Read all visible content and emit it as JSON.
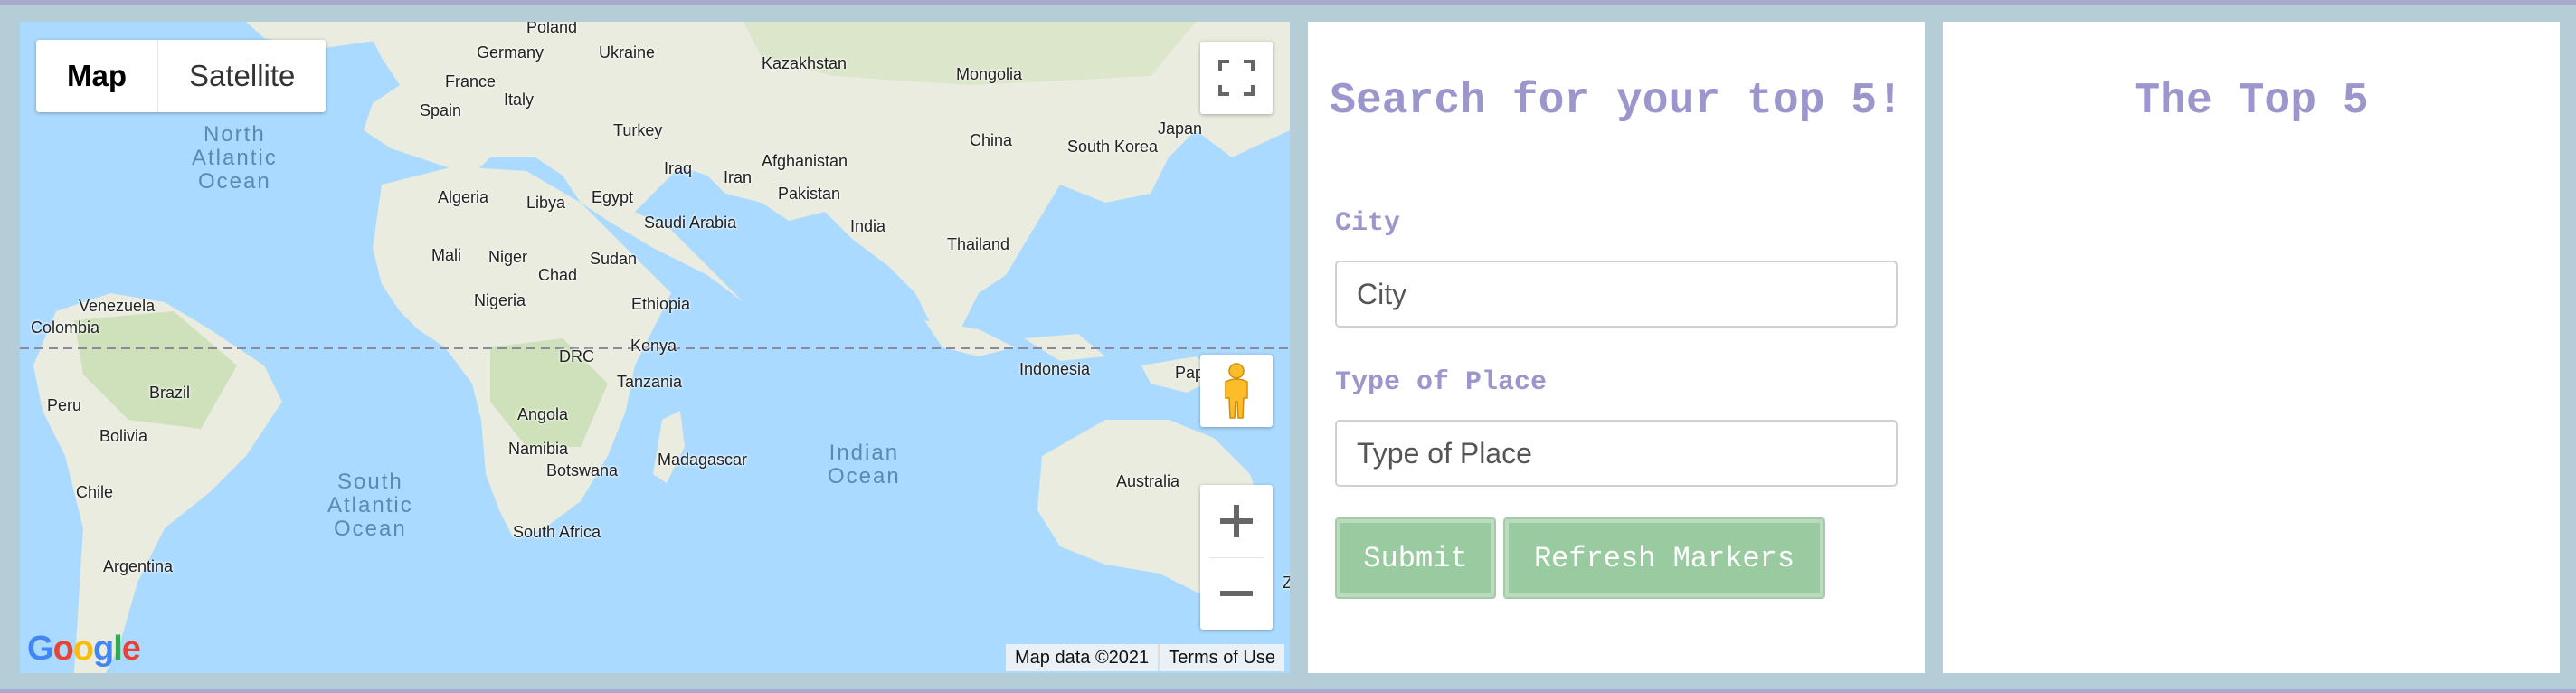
{
  "map": {
    "type_control": {
      "map_label": "Map",
      "satellite_label": "Satellite"
    },
    "attribution": {
      "map_data": "Map data ©2021",
      "terms": "Terms of Use"
    },
    "logo": "Google",
    "countries": [
      "Poland",
      "Germany",
      "Ukraine",
      "Kazakhstan",
      "Mongolia",
      "France",
      "Italy",
      "Spain",
      "Turkey",
      "China",
      "Japan",
      "South Korea",
      "Iraq",
      "Iran",
      "Afghanistan",
      "Pakistan",
      "India",
      "Thailand",
      "Algeria",
      "Libya",
      "Egypt",
      "Saudi Arabia",
      "Mali",
      "Niger",
      "Chad",
      "Sudan",
      "Nigeria",
      "Ethiopia",
      "Venezuela",
      "Colombia",
      "DRC",
      "Kenya",
      "Indonesia",
      "Pap",
      "Brazil",
      "Peru",
      "Tanzania",
      "Angola",
      "Bolivia",
      "Namibia",
      "Botswana",
      "Madagascar",
      "Australia",
      "Chile",
      "South Africa",
      "Argentina",
      "Z"
    ],
    "oceans": [
      "North\nAtlantic\nOcean",
      "South\nAtlantic\nOcean",
      "Indian\nOcean"
    ]
  },
  "search": {
    "title": "Search for your top 5!",
    "city_label": "City",
    "city_placeholder": "City",
    "type_label": "Type of Place",
    "type_placeholder": "Type of Place",
    "submit_label": "Submit",
    "refresh_label": "Refresh Markers"
  },
  "top5": {
    "title": "The Top 5"
  }
}
